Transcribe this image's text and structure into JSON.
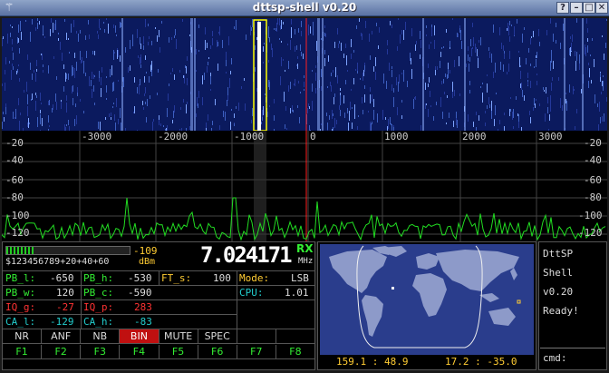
{
  "window": {
    "title": "dttsp-shell v0.20",
    "buttons": [
      "?",
      "–",
      "□",
      "✕"
    ]
  },
  "spectrum": {
    "x_ticks": [
      "-3000",
      "-2000",
      "-1000",
      "0",
      "1000",
      "2000",
      "3000"
    ],
    "y_ticks_left": [
      "-20",
      "-40",
      "-60",
      "-80",
      "-100",
      "-120"
    ],
    "y_ticks_right": [
      "-20",
      "-40",
      "-60",
      "-80",
      "-100",
      "-120"
    ]
  },
  "meter": {
    "scale": "$123456789+20+40+60",
    "unit": "dBm",
    "value": "-109",
    "level_fraction": 0.22
  },
  "frequency": {
    "value": "7.024171",
    "mode_flag": "RX",
    "unit": "MHz"
  },
  "params": [
    {
      "label": "PB_l:",
      "value": "-650"
    },
    {
      "label": "PB_h:",
      "value": "-530"
    },
    {
      "label": "FT_s:",
      "value": "100"
    },
    {
      "label": "Mode:",
      "value": "LSB"
    },
    {
      "label": "PB_w:",
      "value": "120"
    },
    {
      "label": "PB_c:",
      "value": "-590"
    },
    {
      "label": "CPU:",
      "value": "1.01"
    },
    {
      "label": "IQ_g:",
      "value": "-27"
    },
    {
      "label": "IQ_p:",
      "value": "283"
    },
    {
      "label": "CA_l:",
      "value": "-129"
    },
    {
      "label": "CA_h:",
      "value": "-83"
    }
  ],
  "toggles": [
    "NR",
    "ANF",
    "NB",
    "BIN",
    "MUTE",
    "SPEC"
  ],
  "active_toggle": "BIN",
  "fkeys": [
    "F1",
    "F2",
    "F3",
    "F4",
    "F5",
    "F6",
    "F7",
    "F8"
  ],
  "map": {
    "coords_left": "159.1 : 48.9",
    "coords_right": "17.2 : -35.0"
  },
  "shell": {
    "output": [
      "DttSP",
      "Shell",
      "v0.20",
      "Ready!"
    ],
    "prompt": "cmd:"
  },
  "colors": {
    "waterfall_bg": "#0b1a5e",
    "trace": "#22dd22",
    "accent": "#ffcc33",
    "label_green": "#33ee33",
    "label_red": "#ff3333",
    "label_cyan": "#22cccc",
    "bin_active": "#c01010"
  }
}
